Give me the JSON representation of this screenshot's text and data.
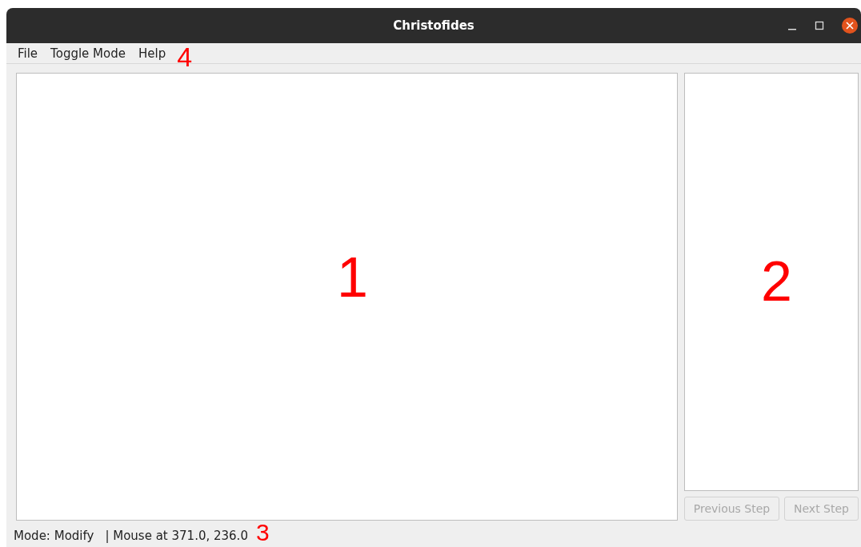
{
  "window": {
    "title": "Christofides"
  },
  "menu": [
    {
      "label": "File"
    },
    {
      "label": "Toggle Mode"
    },
    {
      "label": "Help"
    }
  ],
  "menu_annotation": "4",
  "canvas": {
    "annotation": "1"
  },
  "side_panel": {
    "annotation": "2"
  },
  "buttons": [
    {
      "label": "Previous Step",
      "disabled": true
    },
    {
      "label": "Next Step",
      "disabled": true
    }
  ],
  "status_bar": {
    "mode": "Mode: Modify",
    "mouse": "| Mouse at 371.0, 236.0",
    "annotation": "3"
  }
}
